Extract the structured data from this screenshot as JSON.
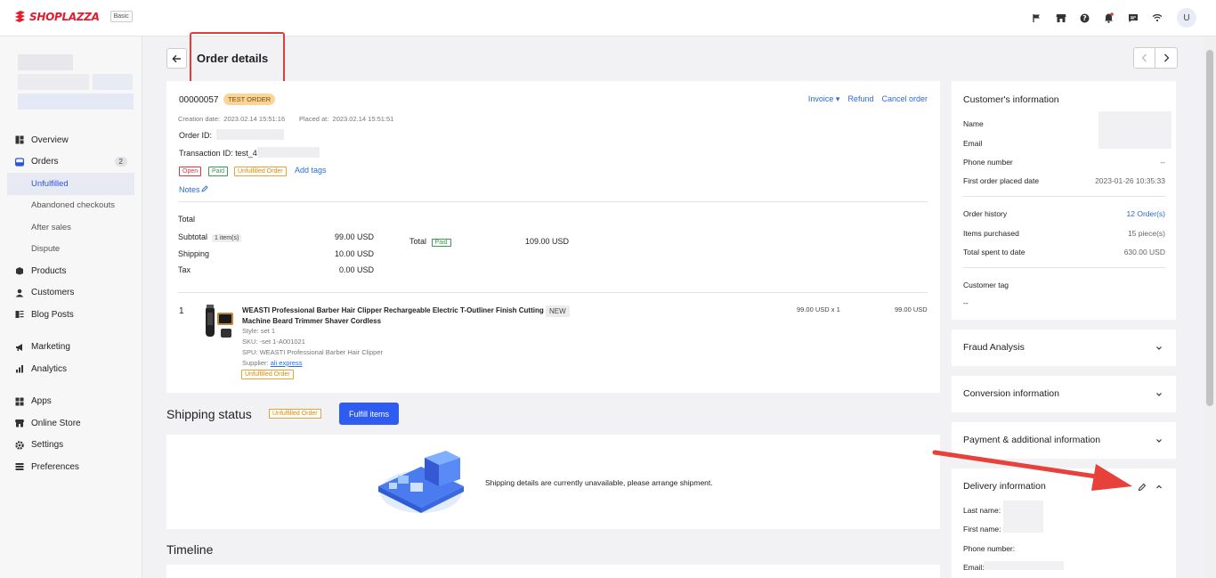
{
  "header": {
    "brand": "SHOPLAZZA",
    "plan": "Basic",
    "avatar_letter": "U",
    "icons": [
      "flag-icon",
      "store-icon",
      "help-icon",
      "bell-icon",
      "chat-icon",
      "wifi-icon"
    ]
  },
  "sidebar": {
    "items": [
      {
        "label": "Overview",
        "icon": "overview-icon"
      },
      {
        "label": "Orders",
        "icon": "orders-icon",
        "count": "2"
      },
      {
        "label": "Unfulfilled",
        "sub": true,
        "active": true
      },
      {
        "label": "Abandoned checkouts",
        "sub": true
      },
      {
        "label": "After sales",
        "sub": true
      },
      {
        "label": "Dispute",
        "sub": true
      },
      {
        "label": "Products",
        "icon": "products-icon"
      },
      {
        "label": "Customers",
        "icon": "customers-icon"
      },
      {
        "label": "Blog Posts",
        "icon": "blog-icon"
      },
      {
        "label": "Marketing",
        "icon": "marketing-icon"
      },
      {
        "label": "Analytics",
        "icon": "analytics-icon"
      },
      {
        "label": "Apps",
        "icon": "apps-icon"
      },
      {
        "label": "Online Store",
        "icon": "store-icon"
      },
      {
        "label": "Settings",
        "icon": "settings-icon"
      },
      {
        "label": "Preferences",
        "icon": "preferences-icon"
      }
    ]
  },
  "page": {
    "title": "Order details"
  },
  "order": {
    "number": "00000057",
    "test_badge": "TEST ORDER",
    "creation_label": "Creation date:",
    "creation_date": "2023.02.14 15:51:16",
    "placed_label": "Placed at:",
    "placed_date": "2023.02.14 15:51:51",
    "order_id_label": "Order ID:",
    "transaction_label": "Transaction ID: test_4",
    "tags": [
      "Open",
      "Paid",
      "Unfulfilled Order"
    ],
    "add_tags": "Add tags",
    "notes": "Notes",
    "actions": {
      "invoice": "Invoice ▾",
      "refund": "Refund",
      "cancel": "Cancel order"
    }
  },
  "totals": {
    "heading": "Total",
    "subtotal_label": "Subtotal",
    "subtotal_chip": "1 item(s)",
    "subtotal_value": "99.00 USD",
    "shipping_label": "Shipping",
    "shipping_value": "10.00 USD",
    "tax_label": "Tax",
    "tax_value": "0.00 USD",
    "total_label": "Total",
    "total_status": "Paid",
    "total_value": "109.00 USD"
  },
  "line_item": {
    "index": "1",
    "title": "WEASTI Professional Barber Hair Clipper Rechargeable Electric T-Outliner Finish Cutting Machine Beard Trimmer Shaver Cordless",
    "new_badge": "NEW",
    "style": "Style: set 1",
    "sku": "SKU: -set 1-A001021",
    "spu": "SPU: WEASTI Professional Barber Hair Clipper",
    "supplier_label": "Supplier:",
    "supplier_link": "ali express",
    "status": "Unfulfilled Order",
    "unit": "99.00 USD x 1",
    "amount": "99.00 USD"
  },
  "shipping": {
    "heading": "Shipping status",
    "badge": "Unfulfilled Order",
    "button": "Fulfill items",
    "message": "Shipping details are currently unavailable, please arrange shipment."
  },
  "timeline": {
    "heading": "Timeline"
  },
  "customer": {
    "title": "Customer's information",
    "name_label": "Name",
    "email_label": "Email",
    "phone_label": "Phone number",
    "phone_value": "--",
    "first_order_label": "First order placed date",
    "first_order_value": "2023-01-26 10:35:33",
    "history_label": "Order history",
    "history_value": "12 Order(s)",
    "items_label": "Items purchased",
    "items_value": "15 piece(s)",
    "spent_label": "Total spent to date",
    "spent_value": "630.00 USD",
    "tag_label": "Customer tag",
    "tag_value": "--"
  },
  "panels": {
    "fraud": "Fraud Analysis",
    "conversion": "Conversion information",
    "payment": "Payment & additional information",
    "delivery": "Delivery information"
  },
  "delivery": {
    "last_name": "Last name:",
    "first_name": "First name:",
    "phone": "Phone number:",
    "email": "Email:"
  },
  "colors": {
    "accent": "#2e5bf0",
    "link": "#2b6ad8",
    "annotation_red": "#e03c3c",
    "test_badge": "#fbd49a"
  }
}
